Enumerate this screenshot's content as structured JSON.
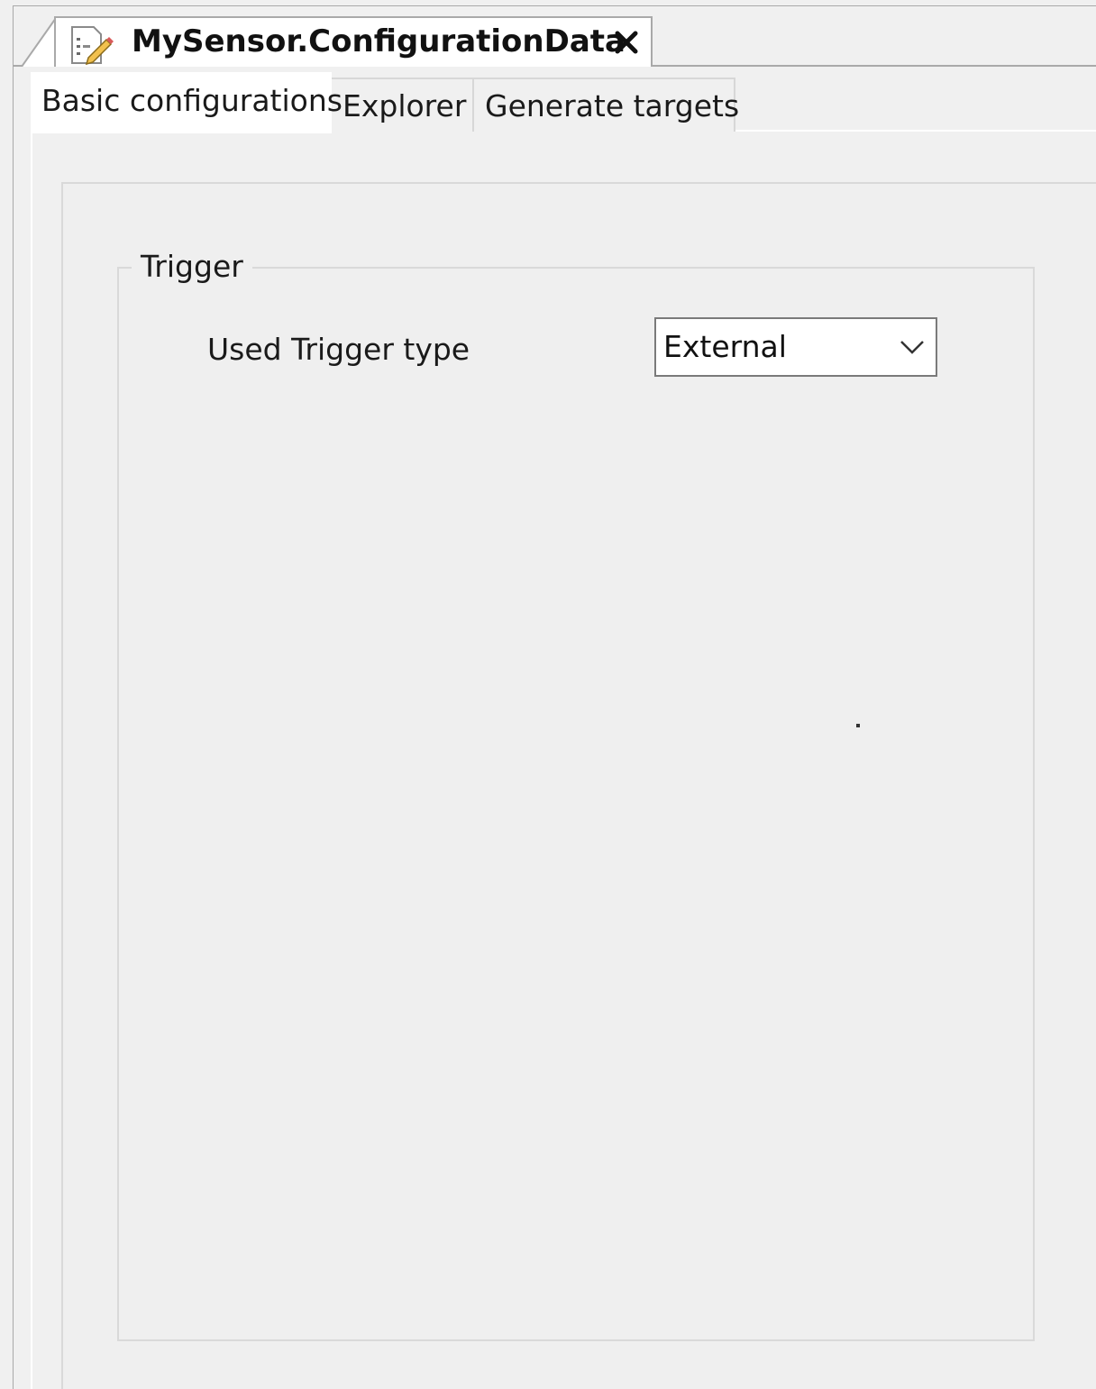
{
  "editor": {
    "document_tab": {
      "title": "MySensor.ConfigurationData",
      "icon": "config-document-icon",
      "close_icon": "close-icon"
    },
    "tabs": [
      {
        "label": "Basic configurations",
        "active": true
      },
      {
        "label": "Explorer",
        "active": false
      },
      {
        "label": "Generate targets",
        "active": false
      }
    ]
  },
  "trigger_group": {
    "legend": "Trigger",
    "field_label": "Used Trigger type",
    "selected_value": "External",
    "dropdown_icon": "chevron-down-icon"
  }
}
